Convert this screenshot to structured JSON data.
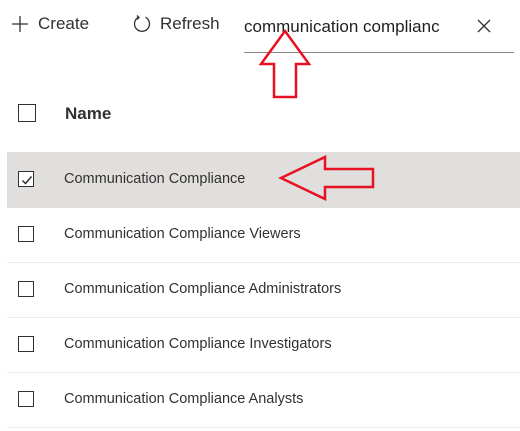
{
  "toolbar": {
    "create_label": "Create",
    "refresh_label": "Refresh",
    "create_icon": "plus-icon",
    "refresh_icon": "refresh-icon"
  },
  "search": {
    "value": "communication complianc",
    "clear_icon": "close-icon"
  },
  "table": {
    "header": {
      "name_label": "Name"
    },
    "rows": [
      {
        "label": "Communication Compliance",
        "checked": true
      },
      {
        "label": "Communication Compliance Viewers",
        "checked": false
      },
      {
        "label": "Communication Compliance Administrators",
        "checked": false
      },
      {
        "label": "Communication Compliance Investigators",
        "checked": false
      },
      {
        "label": "Communication Compliance Analysts",
        "checked": false
      }
    ]
  },
  "colors": {
    "selected_row": "#e1dfdd",
    "annotation_arrow": "#e81123"
  }
}
